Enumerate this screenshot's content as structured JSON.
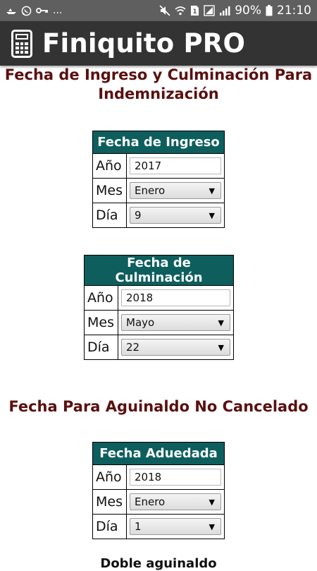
{
  "status_bar": {
    "battery_percent": "90%",
    "time": "21:10",
    "notification_icons": [
      "boat-icon",
      "whatsapp-icon",
      "key-icon",
      "more-icon"
    ],
    "more": "..."
  },
  "app_bar": {
    "title": "Finiquito PRO",
    "icon": "calculator-icon"
  },
  "section1": {
    "title_line1": "Fecha de Ingreso y Culminación Para",
    "title_line2": "Indemnización"
  },
  "table_ingreso": {
    "header": "Fecha de Ingreso",
    "year_label": "Año",
    "year_value": "2017",
    "month_label": "Mes",
    "month_value": "Enero",
    "day_label": "Día",
    "day_value": "9"
  },
  "table_culminacion": {
    "header": "Fecha de Culminación",
    "year_label": "Año",
    "year_value": "2018",
    "month_label": "Mes",
    "month_value": "Mayo",
    "day_label": "Día",
    "day_value": "22"
  },
  "section2": {
    "title": "Fecha Para Aguinaldo No Cancelado"
  },
  "table_aguinaldo": {
    "header": "Fecha Aduedada",
    "year_label": "Año",
    "year_value": "2018",
    "month_label": "Mes",
    "month_value": "Enero",
    "day_label": "Día",
    "day_value": "1"
  },
  "footer": {
    "partial_text": "Doble aguinaldo"
  },
  "colors": {
    "table_header": "#0e5e5e",
    "section_title": "#5a1010",
    "app_bar": "#333333",
    "status_bar": "#5f5f5f"
  }
}
